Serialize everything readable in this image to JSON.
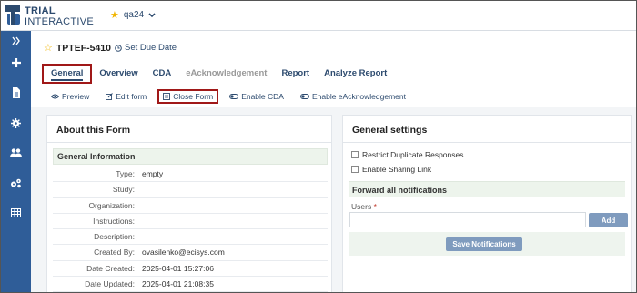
{
  "logo": {
    "line1": "TRIAL",
    "line2": "INTERACTIVE"
  },
  "study": {
    "name": "qa24",
    "star_icon": "star-icon",
    "dropdown_icon": "chevron-down-icon"
  },
  "sidebar": {
    "items": [
      {
        "icon": "double-chevron-right-icon",
        "glyph": "»"
      },
      {
        "icon": "plus-icon",
        "glyph": "+"
      },
      {
        "icon": "document-icon",
        "glyph": ""
      },
      {
        "icon": "gear-icon",
        "glyph": ""
      },
      {
        "icon": "users-icon",
        "glyph": ""
      },
      {
        "icon": "cogs-icon",
        "glyph": ""
      },
      {
        "icon": "table-icon",
        "glyph": ""
      }
    ]
  },
  "form": {
    "id": "TPTEF-5410",
    "set_due_date": "Set Due Date"
  },
  "tabs": [
    {
      "label": "General",
      "state": "active"
    },
    {
      "label": "Overview",
      "state": "normal"
    },
    {
      "label": "CDA",
      "state": "normal"
    },
    {
      "label": "eAcknowledgement",
      "state": "muted"
    },
    {
      "label": "Report",
      "state": "normal"
    },
    {
      "label": "Analyze Report",
      "state": "normal"
    }
  ],
  "actions": {
    "preview": "Preview",
    "edit_form": "Edit form",
    "close_form": "Close Form",
    "enable_cda": "Enable CDA",
    "enable_eack": "Enable eAcknowledgement"
  },
  "about": {
    "title": "About this Form",
    "section": "General Information",
    "rows": [
      {
        "label": "Type:",
        "value": "empty"
      },
      {
        "label": "Study:",
        "value": ""
      },
      {
        "label": "Organization:",
        "value": ""
      },
      {
        "label": "Instructions:",
        "value": ""
      },
      {
        "label": "Description:",
        "value": ""
      },
      {
        "label": "Created By:",
        "value": "ovasilenko@ecisys.com"
      },
      {
        "label": "Date Created:",
        "value": "2025-04-01 15:27:06"
      },
      {
        "label": "Date Updated:",
        "value": "2025-04-01 21:08:35"
      }
    ]
  },
  "settings": {
    "title": "General settings",
    "restrict_dup": "Restrict Duplicate Responses",
    "enable_sharing": "Enable Sharing Link",
    "forward_title": "Forward all notifications",
    "users_label": "Users",
    "required_mark": "*",
    "users_value": "",
    "add_button": "Add",
    "save_button": "Save Notifications"
  },
  "colors": {
    "sidebar": "#2f5d98",
    "brand": "#2c4a6e",
    "highlight_border": "#a01818",
    "button": "#7f9bbe"
  }
}
